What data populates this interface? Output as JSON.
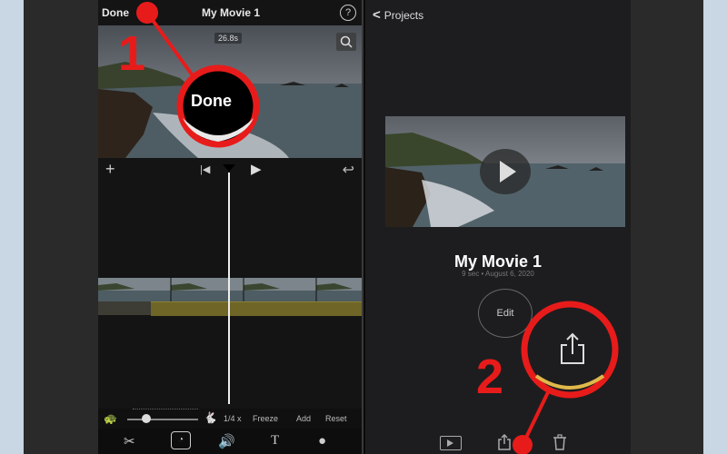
{
  "app": {
    "left_screen": {
      "top_bar": {
        "done_label": "Done",
        "title": "My Movie 1",
        "help_icon": "question-circle-icon"
      },
      "preview": {
        "duration_badge": "26.8s",
        "zoom_icon": "zoom-icon"
      },
      "timeline_controls": {
        "add_icon": "plus-icon",
        "skip_back_icon": "skip-start-icon",
        "play_icon": "play-icon",
        "undo_icon": "undo-icon"
      },
      "speed_bar": {
        "speed_label": "1/4 x",
        "freeze_label": "Freeze",
        "add_label": "Add",
        "reset_label": "Reset",
        "speed_level": 0.18
      },
      "toolbar": {
        "items": [
          "scissors-icon",
          "speed-icon",
          "volume-icon",
          "title-icon",
          "filter-icon"
        ]
      }
    },
    "right_screen": {
      "back_label": "Projects",
      "movie_title": "My Movie 1",
      "movie_subtitle": "9 sec • August 6, 2020",
      "edit_label": "Edit",
      "bottom_tools": [
        "play-icon",
        "share-icon",
        "trash-icon"
      ]
    }
  },
  "annotations": {
    "step1_number": "1",
    "step1_callout": "Done",
    "step2_number": "2",
    "color": "#e81b1b"
  }
}
